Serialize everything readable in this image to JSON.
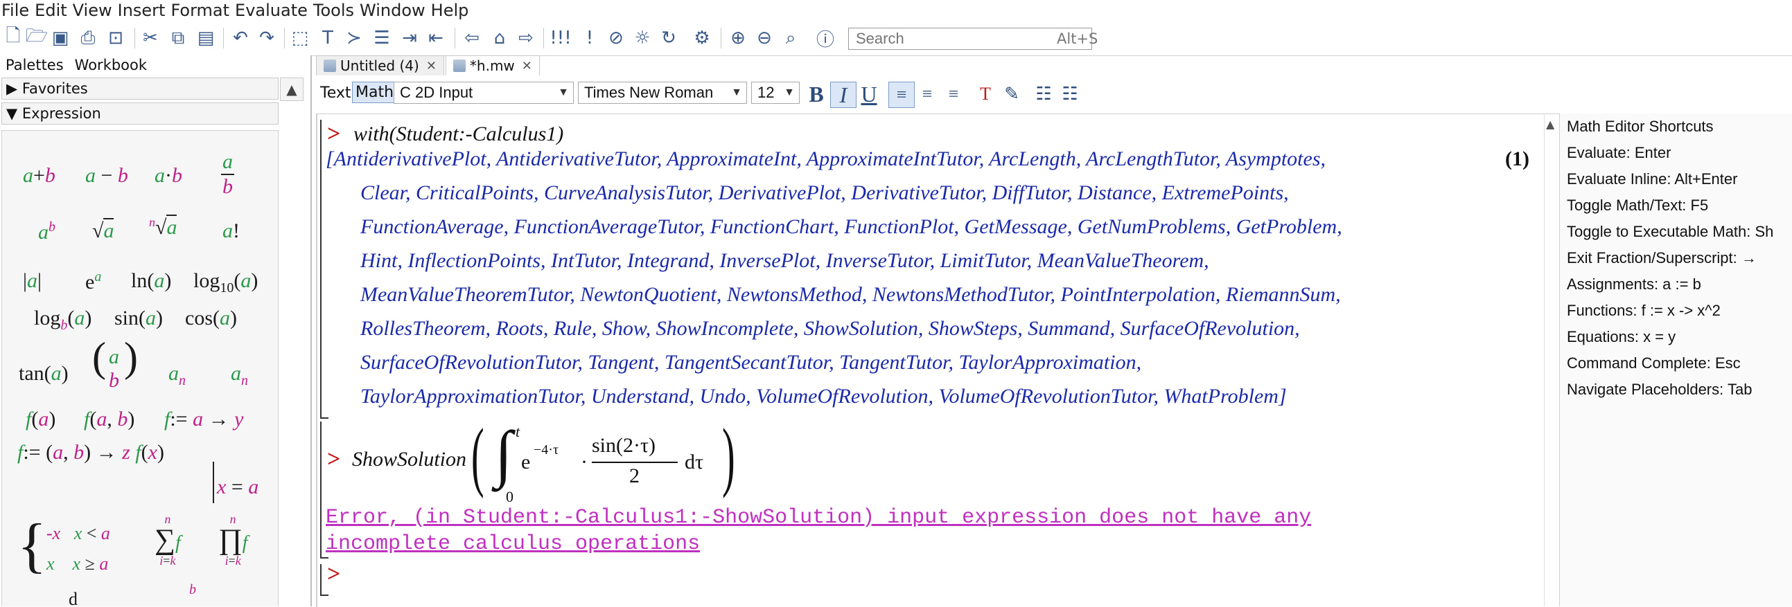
{
  "menu": [
    "File",
    "Edit",
    "View",
    "Insert",
    "Format",
    "Evaluate",
    "Tools",
    "Window",
    "Help"
  ],
  "search": {
    "placeholder": "Search",
    "shortcut": "Alt+S"
  },
  "left_panel": {
    "tabs": [
      "Palettes",
      "Workbook"
    ],
    "favorites_label": "Favorites",
    "expression_label": "Expression"
  },
  "doc_tabs": [
    {
      "label": "Untitled (4)"
    },
    {
      "label": "*h.mw"
    }
  ],
  "format_bar": {
    "text_label": "Text",
    "math_label": "Math",
    "input_mode": "2D Input",
    "font": "Times New Roman",
    "size": "12"
  },
  "worksheet": {
    "prompt": ">",
    "input1": "with(Student:-Calculus1)",
    "equation_label": "(1)",
    "output_lines": [
      "[AntiderivativePlot, AntiderivativeTutor, ApproximateInt, ApproximateIntTutor, ArcLength, ArcLengthTutor, Asymptotes,",
      "Clear, CriticalPoints, CurveAnalysisTutor, DerivativePlot, DerivativeTutor, DiffTutor, Distance, ExtremePoints,",
      "FunctionAverage, FunctionAverageTutor, FunctionChart, FunctionPlot, GetMessage, GetNumProblems, GetProblem,",
      "Hint, InflectionPoints, IntTutor, Integrand, InversePlot, InverseTutor, LimitTutor, MeanValueTheorem,",
      "MeanValueTheoremTutor, NewtonQuotient, NewtonsMethod, NewtonsMethodTutor, PointInterpolation, RiemannSum,",
      "RollesTheorem, Roots, Rule, Show, ShowIncomplete, ShowSolution, ShowSteps, Summand, SurfaceOfRevolution,",
      "SurfaceOfRevolutionTutor, Tangent, TangentSecantTutor, TangentTutor, TaylorApproximation,",
      "TaylorApproximationTutor, Understand, Undo, VolumeOfRevolution, VolumeOfRevolutionTutor, WhatProblem]"
    ],
    "input2": {
      "command": "ShowSolution",
      "upper": "t",
      "lower": "0",
      "exp_base": "e",
      "exponent": "−4·τ",
      "dot": "·",
      "numerator": "sin(2·τ)",
      "denominator": "2",
      "differential": "dτ"
    },
    "error_lines": [
      "Error, (in Student:-Calculus1:-ShowSolution) input expression does not have any",
      "incomplete calculus operations"
    ]
  },
  "shortcuts": {
    "title": "Math Editor Shortcuts",
    "rows": [
      "Evaluate:  Enter",
      "Evaluate Inline:  Alt+Enter",
      "Toggle Math/Text:  F5",
      "Toggle to Executable Math:  Sh",
      "Exit Fraction/Superscript:  →",
      "Assignments:  a := b",
      "Functions:  f := x -> x^2",
      "Equations:  x = y",
      "Command Complete:  Esc",
      "Navigate Placeholders:  Tab"
    ]
  },
  "colors": {
    "output_blue": "#1b2aa8",
    "error_magenta": "#c030c0",
    "prompt_red": "#c01818",
    "palette_green": "#2a9a4a",
    "palette_magenta": "#c0208a"
  }
}
